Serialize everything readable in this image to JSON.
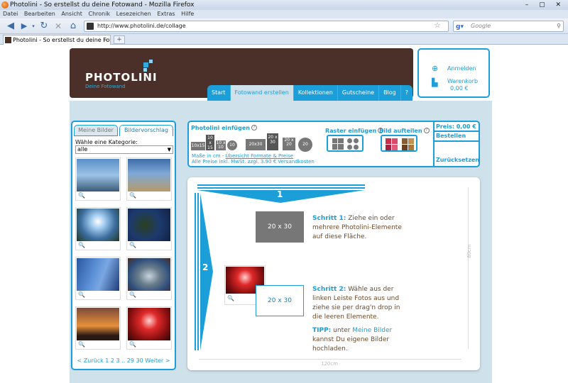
{
  "browser": {
    "title": "Photolini - So erstellst du deine Fotowand - Mozilla Firefox",
    "menu": [
      "Datei",
      "Bearbeiten",
      "Ansicht",
      "Chronik",
      "Lesezeichen",
      "Extras",
      "Hilfe"
    ],
    "url": "http://www.photolini.de/collage",
    "search_placeholder": "Google",
    "tab_title": "Photolini - So erstellst du deine Foto...",
    "new_tab": "+",
    "tab_close": "×"
  },
  "header": {
    "brand": "PHOTOLINI",
    "slogan": "Deine Fotowand",
    "nav": [
      "Start",
      "Fotowand erstellen",
      "Kollektionen",
      "Gutscheine",
      "Blog",
      "?"
    ],
    "active_nav": "Fotowand erstellen",
    "accent": "#1c9ed9",
    "brown": "#4a3028"
  },
  "account": {
    "login": "Anmelden",
    "cart": "Warenkorb",
    "cart_total": "0,00 €"
  },
  "left_panel": {
    "tab_inactive": "Meine Bilder",
    "tab_active": "Bildervorschlag",
    "category_label": "Wähle eine Kategorie:",
    "category_value": "alle",
    "pager": "< Zurück 1 2 3 .. 29 30 Weiter >"
  },
  "toolbar": {
    "insert_title": "Photolini einfügen",
    "elements": [
      "10x15",
      "10 x 15",
      "10 x 10",
      "10",
      "20x30",
      "20 x 30",
      "20 x 20",
      "20"
    ],
    "masse_prefix": "Maße in cm -",
    "masse_link": "Übersicht Formate & Preise",
    "preise": "Alle Preise inkl. MwSt. zzgl. 3.90 € Versandkosten",
    "raster_title": "Raster einfügen",
    "split_title": "Bild aufteilen",
    "price": "Preis: 0,00 €",
    "order": "Bestellen",
    "reset": "Zurücksetzen"
  },
  "canvas": {
    "step1_num": "1",
    "step2_num": "2",
    "width_label": "120cm",
    "height_label": "80cm",
    "box_label": "20 x 30",
    "step1_title": "Schritt 1:",
    "step1_text": "Ziehe ein oder mehrere Photolini-Elemente auf diese Fläche.",
    "step2_title": "Schritt 2:",
    "step2_text": "Wähle aus der linken Leiste Fotos aus und ziehe sie per drag'n drop in die leeren Elemente.",
    "tip_title": "TIPP:",
    "tip_pre": "unter",
    "tip_link": "Meine Bilder",
    "tip_post": "kannst Du eigene Bilder hochladen."
  }
}
